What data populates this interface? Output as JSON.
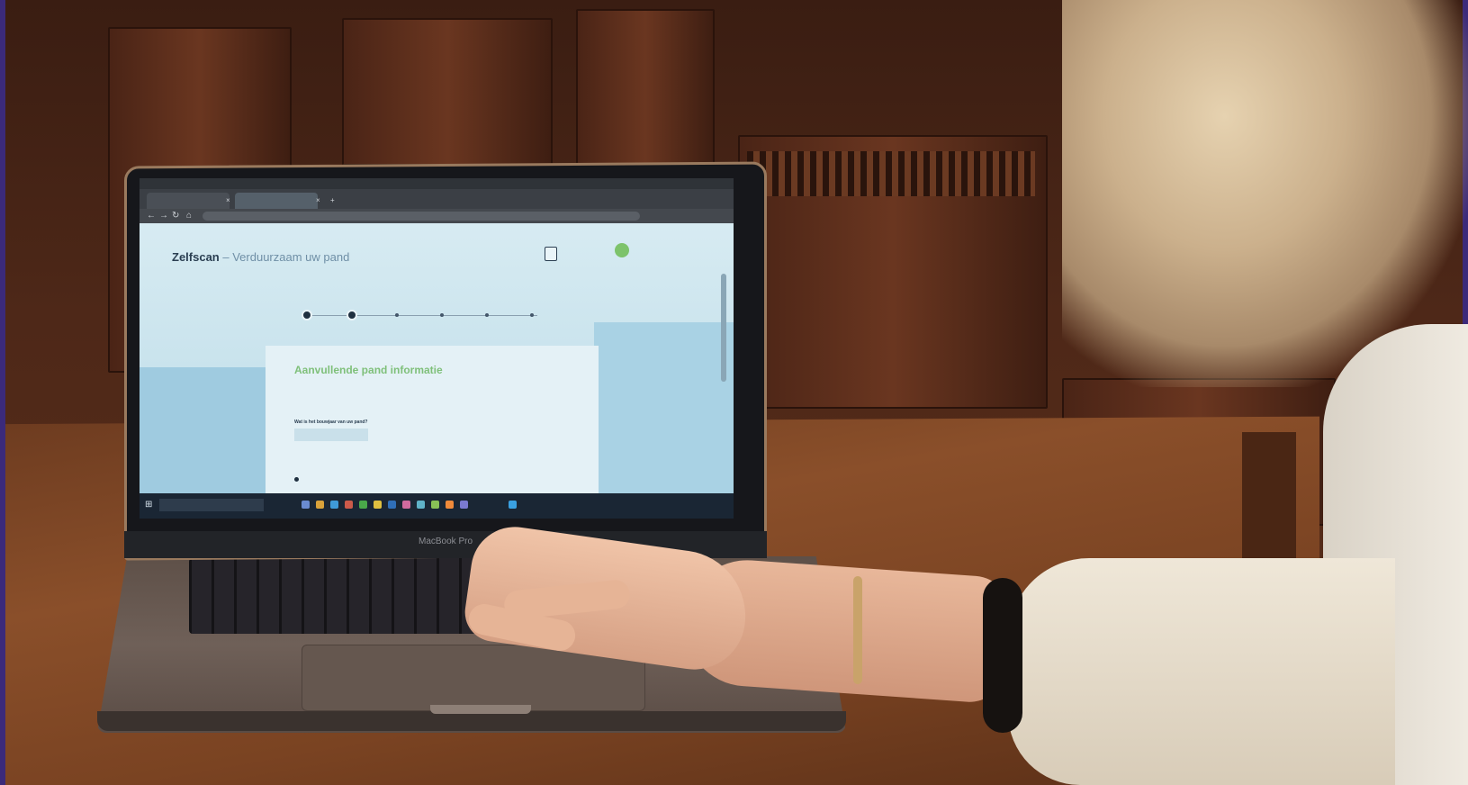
{
  "laptop": {
    "model_label": "MacBook Pro"
  },
  "browser": {
    "tabs": [
      {
        "label": ""
      },
      {
        "label": ""
      }
    ],
    "url": ""
  },
  "site": {
    "brand": "Zelfscan",
    "brand_separator": " – ",
    "brand_subtitle": "Verduurzaam uw pand",
    "header_button": "",
    "steps_total": 6,
    "steps_completed": 2
  },
  "form": {
    "title": "Aanvullende pand informatie",
    "subtitle": "",
    "question_1": "Wat is het bouwjaar van uw pand?",
    "input_1_value": "",
    "question_2": "",
    "option_1": ""
  },
  "colors": {
    "accent_green": "#7fc07a",
    "navy": "#1f3040",
    "screen_blue": "#b9dbe6",
    "frame": "#3b2a7a"
  },
  "icons": [
    "windows-start-icon",
    "back-arrow-icon",
    "forward-arrow-icon",
    "refresh-icon",
    "close-icon",
    "avatar-icon"
  ]
}
